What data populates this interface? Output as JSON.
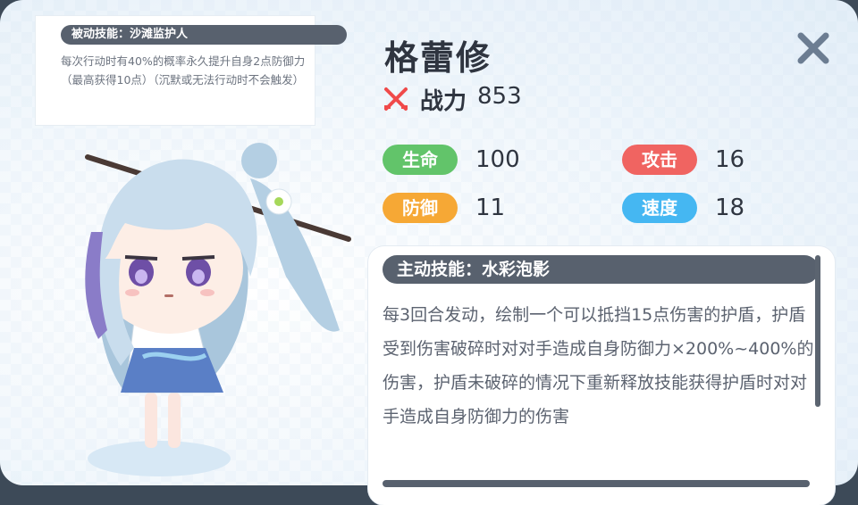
{
  "passive_skill": {
    "title": "被动技能：沙滩监护人",
    "description": "每次行动时有40%的概率永久提升自身2点防御力（最高获得10点）（沉默或无法行动时不会触发）"
  },
  "character": {
    "name": "格蕾修",
    "power_label": "战力",
    "power_value": "853"
  },
  "stats": [
    {
      "label": "生命",
      "value": "100",
      "color": "#62c46a"
    },
    {
      "label": "攻击",
      "value": "16",
      "color": "#f06461"
    },
    {
      "label": "防御",
      "value": "11",
      "color": "#f6a835"
    },
    {
      "label": "速度",
      "value": "18",
      "color": "#45b7f2"
    }
  ],
  "active_skill": {
    "title": "主动技能：水彩泡影",
    "description": "每3回合发动，绘制一个可以抵挡15点伤害的护盾，护盾受到伤害破碎时对对手造成自身防御力×200%~400%的伤害，护盾未破碎的情况下重新释放技能获得护盾时对对手造成自身防御力的伤害"
  },
  "icons": {
    "close": "close-icon",
    "power": "crossed-swords-icon"
  }
}
